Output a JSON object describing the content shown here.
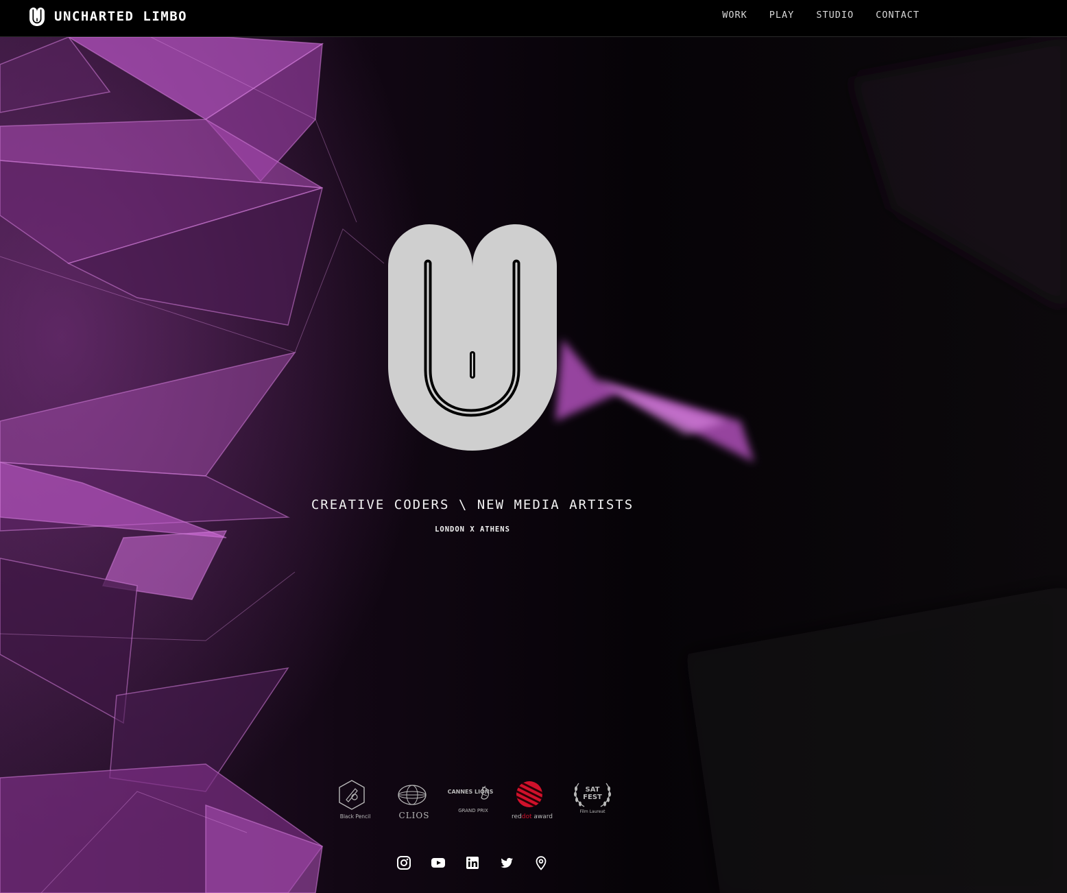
{
  "header": {
    "brand_name": "UNCHARTED LIMBO",
    "nav": [
      {
        "label": "WORK"
      },
      {
        "label": "PLAY"
      },
      {
        "label": "STUDIO"
      },
      {
        "label": "CONTACT"
      }
    ]
  },
  "hero": {
    "tagline": "CREATIVE CODERS \\ NEW MEDIA ARTISTS",
    "location": "LONDON X ATHENS"
  },
  "awards": [
    {
      "name": "Black Pencil",
      "icon": "dandad-pencil-icon"
    },
    {
      "name": "CLIOS",
      "icon": "clios-globe-icon"
    },
    {
      "name": "CANNES LIONS",
      "caption": "GRAND PRIX",
      "icon": "cannes-lions-icon"
    },
    {
      "name": "red",
      "name_accent": "dot",
      "name_suffix": " award",
      "icon": "reddot-icon"
    },
    {
      "name": "SAT",
      "name_line2": "FEST",
      "caption": "Film Laureat",
      "icon": "satfest-laurel-icon"
    }
  ],
  "socials": [
    {
      "icon": "instagram-icon"
    },
    {
      "icon": "youtube-icon"
    },
    {
      "icon": "linkedin-icon"
    },
    {
      "icon": "twitter-icon"
    },
    {
      "icon": "location-pin-icon"
    }
  ],
  "colors": {
    "accent_magenta": "#c65ad0",
    "logo_fill": "#cfcfcf",
    "background": "#050306",
    "reddot_red": "#d0112b"
  }
}
